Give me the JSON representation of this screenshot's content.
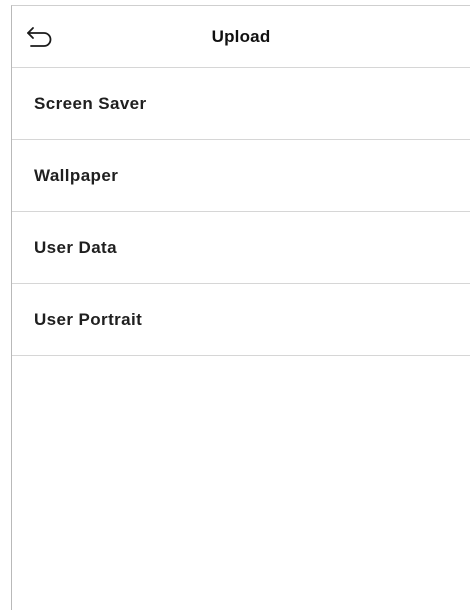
{
  "header": {
    "title": "Upload",
    "back_icon": "back-arrow-icon"
  },
  "menu": {
    "items": [
      {
        "label": "Screen Saver"
      },
      {
        "label": "Wallpaper"
      },
      {
        "label": "User Data"
      },
      {
        "label": "User Portrait"
      }
    ]
  },
  "colors": {
    "background": "#ffffff",
    "divider": "#d6d6d6",
    "text": "#1f1f1f"
  }
}
